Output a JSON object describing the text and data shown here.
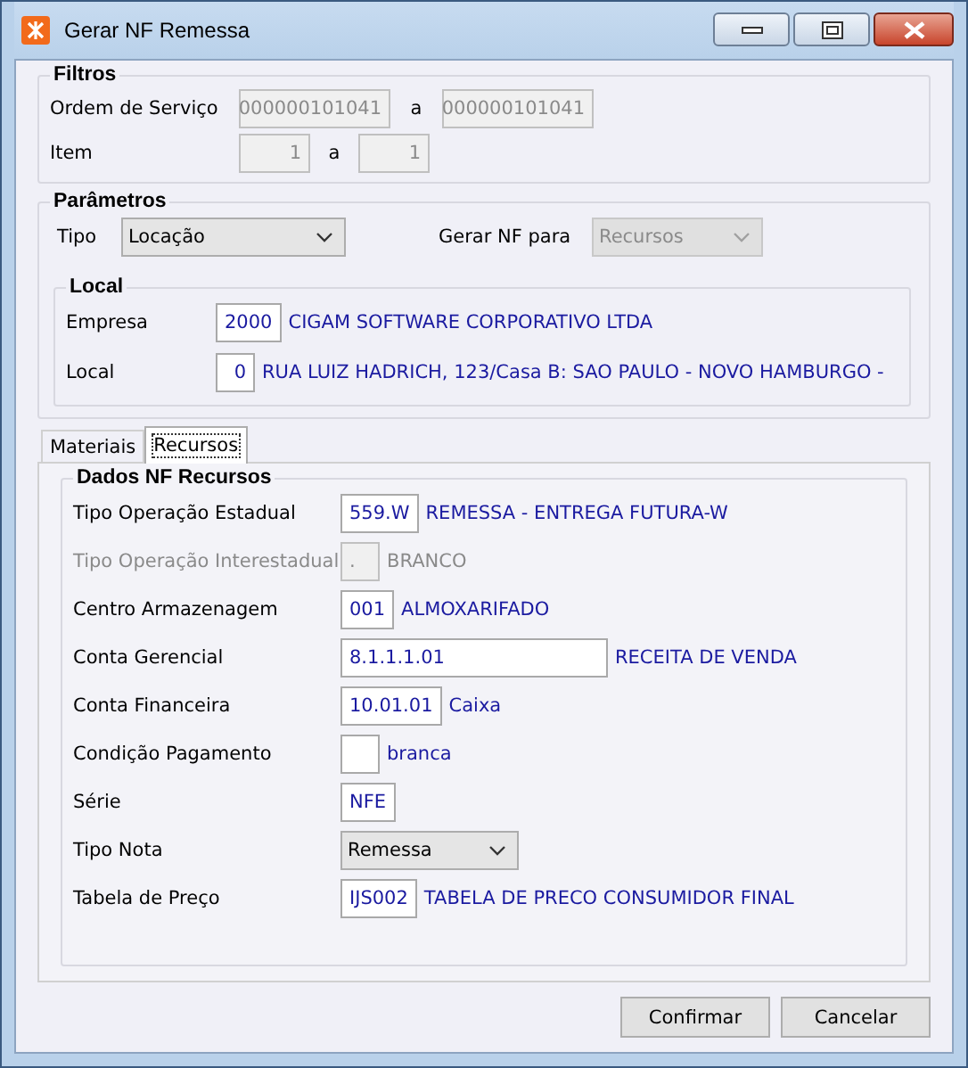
{
  "window": {
    "title": "Gerar NF Remessa"
  },
  "filtros": {
    "title": "Filtros",
    "rows": [
      {
        "label": "Ordem de Serviço",
        "from": "000000101041",
        "separator": "a",
        "to": "000000101041",
        "kind": "wide",
        "disabled": true
      },
      {
        "label": "Item",
        "from": "1",
        "separator": "a",
        "to": "1",
        "kind": "narrow",
        "disabled": true
      }
    ]
  },
  "parametros": {
    "title": "Parâmetros",
    "tipo": {
      "label": "Tipo",
      "value": "Locação",
      "disabled": false
    },
    "gerar_nf_para": {
      "label": "Gerar NF para",
      "value": "Recursos",
      "disabled": true
    },
    "local": {
      "title": "Local",
      "rows": [
        {
          "label": "Empresa",
          "code": "2000",
          "description": "CIGAM SOFTWARE CORPORATIVO LTDA"
        },
        {
          "label": "Local",
          "code": "0",
          "description": "RUA LUIZ HADRICH, 123/Casa B: SAO PAULO - NOVO HAMBURGO -"
        }
      ]
    }
  },
  "tabs": [
    {
      "label": "Materiais",
      "selected": false
    },
    {
      "label": "Recursos",
      "selected": true
    }
  ],
  "dados": {
    "title": "Dados NF Recursos",
    "rows": [
      {
        "kind": "lookup",
        "label": "Tipo Operação Estadual",
        "value": "559.W",
        "description": "REMESSA - ENTREGA FUTURA-W",
        "disabled": false
      },
      {
        "kind": "lookup",
        "label": "Tipo Operação Interestadual",
        "value": ".",
        "description": "BRANCO",
        "disabled": true
      },
      {
        "kind": "lookup",
        "label": "Centro Armazenagem",
        "value": "001",
        "description": "ALMOXARIFADO",
        "disabled": false
      },
      {
        "kind": "wide",
        "label": "Conta Gerencial",
        "value": "8.1.1.1.01",
        "description": "RECEITA DE VENDA",
        "disabled": false
      },
      {
        "kind": "lookup",
        "label": "Conta Financeira",
        "value": "10.01.01",
        "description": "Caixa",
        "disabled": false
      },
      {
        "kind": "lookup",
        "label": "Condição Pagamento",
        "description": "branca",
        "disabled": false
      },
      {
        "kind": "lookup",
        "label": "Série",
        "value": "NFE",
        "disabled": false
      },
      {
        "kind": "combo",
        "label": "Tipo Nota",
        "value": "Remessa",
        "disabled": false
      },
      {
        "kind": "lookup",
        "label": "Tabela de Preço",
        "value": "IJS002",
        "description": "TABELA DE PRECO CONSUMIDOR FINAL",
        "disabled": false
      }
    ]
  },
  "buttons": [
    {
      "label": "Confirmar"
    },
    {
      "label": "Cancelar"
    }
  ]
}
